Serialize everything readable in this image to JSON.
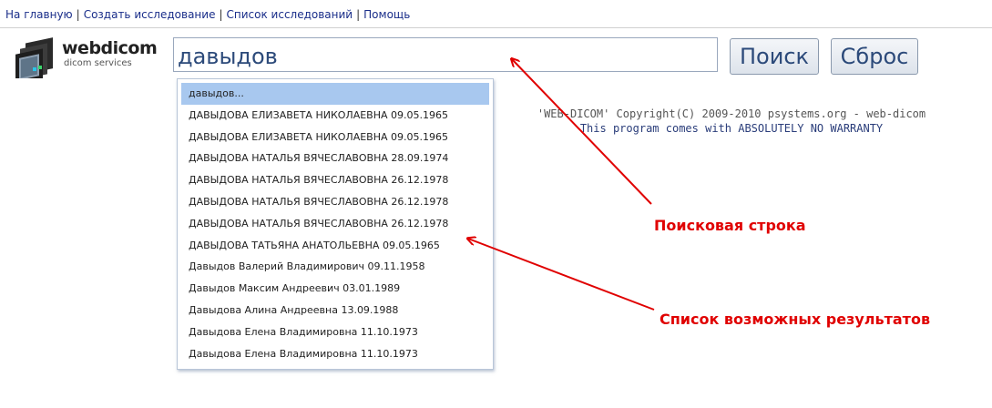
{
  "nav": {
    "home": "На главную",
    "create": "Создать исследование",
    "list": "Список исследований",
    "help": "Помощь",
    "separator": "|"
  },
  "logo": {
    "brand": "webdicom",
    "sub": "dicom services"
  },
  "search": {
    "value": "давыдов"
  },
  "buttons": {
    "search": "Поиск",
    "reset": "Сброс"
  },
  "dropdown": {
    "items": [
      "давыдов...",
      "ДАВЫДОВА ЕЛИЗАВЕТА НИКОЛАЕВНА 09.05.1965",
      "ДАВЫДОВА ЕЛИЗАВЕТА НИКОЛАЕВНА 09.05.1965",
      "ДАВЫДОВА НАТАЛЬЯ ВЯЧЕСЛАВОВНА 28.09.1974",
      "ДАВЫДОВА НАТАЛЬЯ ВЯЧЕСЛАВОВНА 26.12.1978",
      "ДАВЫДОВА НАТАЛЬЯ ВЯЧЕСЛАВОВНА 26.12.1978",
      "ДАВЫДОВА НАТАЛЬЯ ВЯЧЕСЛАВОВНА 26.12.1978",
      "ДАВЫДОВА ТАТЬЯНА АНАТОЛЬЕВНА 09.05.1965",
      "Давыдов Валерий Владимирович 09.11.1958",
      "Давыдов Максим Андреевич 03.01.1989",
      "Давыдова Алина Андреевна 13.09.1988",
      "Давыдова Елена Владимировна 11.10.1973",
      "Давыдова Елена Владимировна 11.10.1973"
    ],
    "selected_index": 0
  },
  "copyright": {
    "line1": "'WEB-DICOM' Copyright(C) 2009-2010 psystems.org - web-dicom",
    "line2": "This program comes with ABSOLUTELY NO WARRANTY"
  },
  "annotations": {
    "search_bar": "Поисковая строка",
    "results_list": "Список возможных результатов"
  },
  "colors": {
    "annotation": "#e00000",
    "link": "#1a2e8a",
    "selected": "#a8c8ef"
  }
}
